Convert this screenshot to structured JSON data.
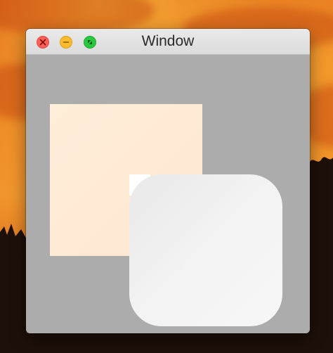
{
  "window": {
    "title": "Window",
    "controls": {
      "close": "close-icon",
      "minimize": "minimize-icon",
      "zoom": "zoom-icon"
    }
  },
  "colors": {
    "close": "#fc5f57",
    "minimize": "#fdbc2e",
    "zoom": "#28c840",
    "content_bg": "#acacac",
    "square_fill": "#ffeed9",
    "rounded_fill": "#f0f0f0"
  }
}
